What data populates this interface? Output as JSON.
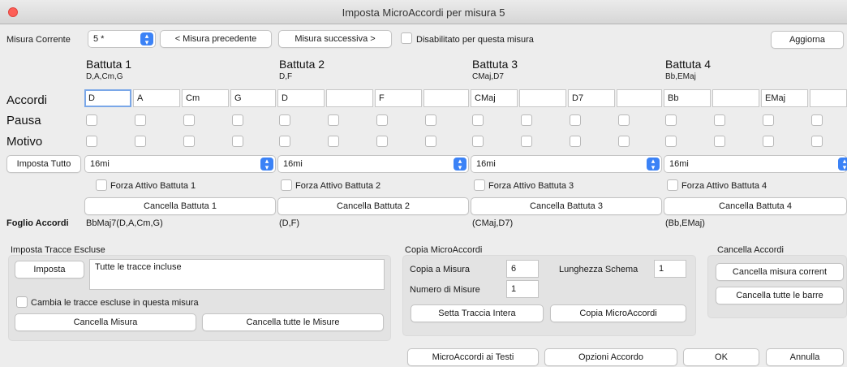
{
  "window": {
    "title": "Imposta MicroAccordi per misura 5"
  },
  "toolbar": {
    "current_measure_label": "Misura Corrente",
    "current_measure_value": "5 *",
    "prev_button": "< Misura precedente",
    "next_button": "Misura successiva >",
    "disable_label": "Disabilitato per questa misura",
    "refresh_button": "Aggiorna"
  },
  "row_labels": {
    "chords": "Accordi",
    "rest": "Pausa",
    "motif": "Motivo",
    "foglio": "Foglio Accordi"
  },
  "beats": [
    {
      "title": "Battuta 1",
      "subtitle": "D,A,Cm,G",
      "chords": [
        "D",
        "A",
        "Cm",
        "G"
      ],
      "preset": "16mi",
      "force_label": "Forza Attivo Battuta 1",
      "clear_label": "Cancella Battuta 1",
      "foglio": "BbMaj7(D,A,Cm,G)"
    },
    {
      "title": "Battuta 2",
      "subtitle": "D,F",
      "chords": [
        "D",
        "",
        "F",
        ""
      ],
      "preset": "16mi",
      "force_label": "Forza Attivo Battuta 2",
      "clear_label": "Cancella Battuta 2",
      "foglio": "(D,F)"
    },
    {
      "title": "Battuta 3",
      "subtitle": "CMaj,D7",
      "chords": [
        "CMaj",
        "",
        "D7",
        ""
      ],
      "preset": "16mi",
      "force_label": "Forza Attivo Battuta 3",
      "clear_label": "Cancella Battuta 3",
      "foglio": "(CMaj,D7)"
    },
    {
      "title": "Battuta 4",
      "subtitle": "Bb,EMaj",
      "chords": [
        "Bb",
        "",
        "EMaj",
        ""
      ],
      "preset": "16mi",
      "force_label": "Forza Attivo Battuta 4",
      "clear_label": "Cancella Battuta 4",
      "foglio": "(Bb,EMaj)"
    }
  ],
  "set_all_button": "Imposta Tutto",
  "excluded": {
    "title": "Imposta Tracce Escluse",
    "set_button": "Imposta",
    "text": "Tutte le tracce incluse",
    "change_label": "Cambia le tracce escluse in questa misura",
    "clear_measure": "Cancella Misura",
    "clear_all": "Cancella tutte le Misure"
  },
  "copy": {
    "title": "Copia MicroAccordi",
    "copy_to_label": "Copia a Misura",
    "copy_to_value": "6",
    "length_label": "Lunghezza Schema",
    "length_value": "1",
    "count_label": "Numero di Misure",
    "count_value": "1",
    "set_track_button": "Setta Traccia Intera",
    "copy_button": "Copia MicroAccordi"
  },
  "clear_chords": {
    "title": "Cancella Accordi",
    "current_button": "Cancella misura corrent",
    "all_button": "Cancella tutte le barre"
  },
  "footer": {
    "lyrics_button": "MicroAccordi ai Testi",
    "options_button": "Opzioni Accordo",
    "ok_button": "OK",
    "cancel_button": "Annulla"
  }
}
